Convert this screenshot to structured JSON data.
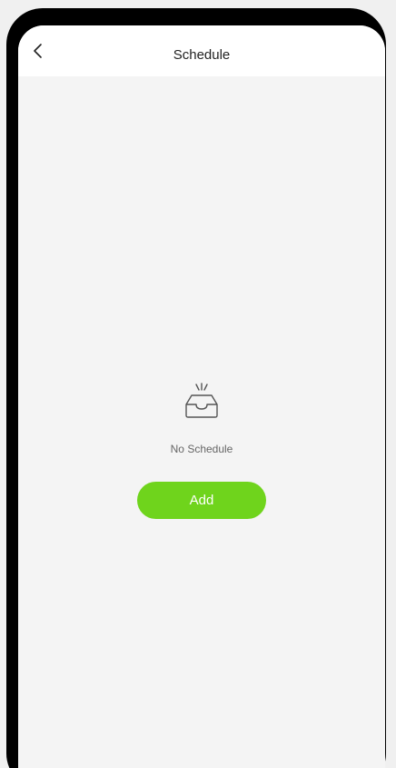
{
  "header": {
    "title": "Schedule",
    "back_icon": "chevron-left-icon"
  },
  "empty_state": {
    "icon": "empty-inbox-icon",
    "message": "No Schedule",
    "add_label": "Add"
  },
  "colors": {
    "accent": "#6fd41c",
    "background": "#f4f4f4",
    "frame": "#000000"
  }
}
